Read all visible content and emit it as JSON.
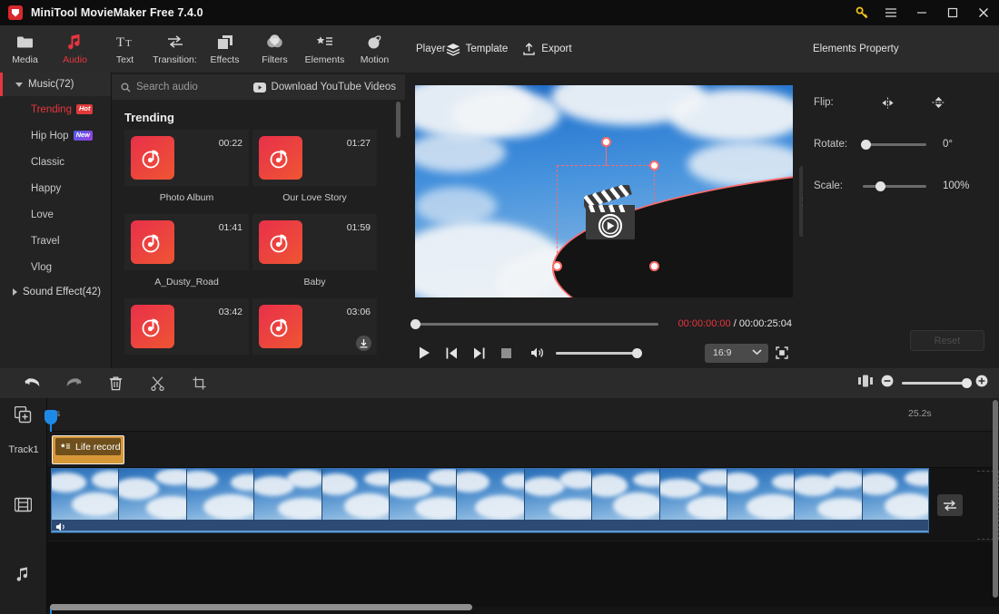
{
  "app": {
    "title": "MiniTool MovieMaker Free 7.4.0",
    "logo_icon": "minitool-logo-icon"
  },
  "window_controls": [
    {
      "name": "license-key-button",
      "icon": "key-icon"
    },
    {
      "name": "menu-button",
      "icon": "hamburger-icon"
    },
    {
      "name": "minimize-button",
      "icon": "minimize-icon"
    },
    {
      "name": "maximize-button",
      "icon": "maximize-icon"
    },
    {
      "name": "close-button",
      "icon": "close-icon"
    }
  ],
  "toolbar": {
    "items": [
      {
        "label": "Media",
        "icon": "folder-icon",
        "active": false
      },
      {
        "label": "Audio",
        "icon": "music-note-icon",
        "active": true
      },
      {
        "label": "Text",
        "icon": "text-icon",
        "active": false
      },
      {
        "label": "Transition:",
        "icon": "transition-arrows-icon",
        "active": false
      },
      {
        "label": "Effects",
        "icon": "layers-square-icon",
        "active": false
      },
      {
        "label": "Filters",
        "icon": "filters-circles-icon",
        "active": false
      },
      {
        "label": "Elements",
        "icon": "elements-star-list-icon",
        "active": false
      },
      {
        "label": "Motion",
        "icon": "motion-sphere-icon",
        "active": false
      }
    ]
  },
  "categories": {
    "music_group": "Music(72)",
    "items": [
      {
        "label": "Trending",
        "badge": "Hot",
        "badge_type": "hot",
        "selected": true
      },
      {
        "label": "Hip Hop",
        "badge": "New",
        "badge_type": "new",
        "selected": false
      },
      {
        "label": "Classic",
        "badge": "",
        "badge_type": "",
        "selected": false
      },
      {
        "label": "Happy",
        "badge": "",
        "badge_type": "",
        "selected": false
      },
      {
        "label": "Love",
        "badge": "",
        "badge_type": "",
        "selected": false
      },
      {
        "label": "Travel",
        "badge": "",
        "badge_type": "",
        "selected": false
      },
      {
        "label": "Vlog",
        "badge": "",
        "badge_type": "",
        "selected": false
      }
    ],
    "sound_effect_group": "Sound Effect(42)"
  },
  "library": {
    "search_placeholder": "Search audio",
    "search_icon": "search-icon",
    "youtube_label": "Download YouTube Videos",
    "youtube_icon": "youtube-icon",
    "section_title": "Trending",
    "tracks": [
      {
        "name": "Photo Album",
        "duration": "00:22",
        "downloadable": false
      },
      {
        "name": "Our Love Story",
        "duration": "01:27",
        "downloadable": false
      },
      {
        "name": "A_Dusty_Road",
        "duration": "01:41",
        "downloadable": false
      },
      {
        "name": "Baby",
        "duration": "01:59",
        "downloadable": false
      },
      {
        "name": "",
        "duration": "03:42",
        "downloadable": false
      },
      {
        "name": "",
        "duration": "03:06",
        "downloadable": true
      }
    ]
  },
  "player": {
    "title": "Player",
    "template_label": "Template",
    "template_icon": "layers-icon",
    "export_label": "Export",
    "export_icon": "upload-icon",
    "current_time": "00:00:00:00",
    "separator": "/",
    "total_time": "00:00:25:04",
    "aspect_ratio": "16:9",
    "controls": [
      {
        "name": "play-button",
        "icon": "play-icon"
      },
      {
        "name": "previous-frame-button",
        "icon": "skip-previous-icon"
      },
      {
        "name": "next-frame-button",
        "icon": "skip-next-icon"
      },
      {
        "name": "stop-button",
        "icon": "stop-icon"
      },
      {
        "name": "volume-button",
        "icon": "volume-icon"
      }
    ],
    "fullscreen_icon": "fullscreen-icon",
    "selected_element_icon": "clapperboard-play-icon"
  },
  "properties": {
    "title": "Elements Property",
    "flip_label": "Flip:",
    "flip_horizontal_icon": "flip-horizontal-icon",
    "flip_vertical_icon": "flip-vertical-icon",
    "rotate_label": "Rotate:",
    "rotate_value": "0°",
    "scale_label": "Scale:",
    "scale_value": "100%",
    "reset_label": "Reset"
  },
  "timeline_toolbar": {
    "buttons": [
      {
        "name": "undo-button",
        "icon": "undo-arrow-icon"
      },
      {
        "name": "redo-button",
        "icon": "redo-arrow-icon"
      },
      {
        "name": "delete-button",
        "icon": "trash-icon"
      },
      {
        "name": "split-button",
        "icon": "scissors-icon"
      },
      {
        "name": "crop-button",
        "icon": "crop-icon"
      }
    ],
    "split-audio-icon": "split-audio-icon",
    "zoom_out_icon": "zoom-out-icon",
    "zoom_in_icon": "zoom-in-icon"
  },
  "timeline": {
    "add_media_icon": "add-media-icon",
    "video_track_icon": "film-strip-icon",
    "audio_track_icon": "music-note-track-icon",
    "track1_label": "Track1",
    "ruler_start": "0s",
    "ruler_end": "25.2s",
    "element_clip_label": "Life record",
    "element_clip_icon": "elements-star-list-icon",
    "video_clip_mute_icon": "volume-icon",
    "swap_icon": "swap-arrows-icon"
  },
  "colors": {
    "accent_red": "#e8353f",
    "playhead_blue": "#1e8ae8",
    "clip_orange": "#d79838",
    "key_yellow": "#f5c518"
  }
}
